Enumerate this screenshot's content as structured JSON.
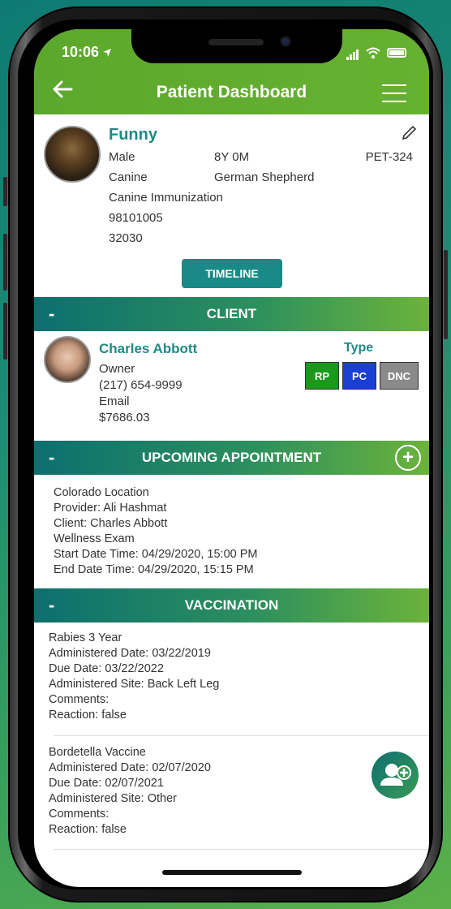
{
  "status_bar": {
    "time": "10:06"
  },
  "header": {
    "title": "Patient Dashboard"
  },
  "patient": {
    "name": "Funny",
    "sex": "Male",
    "age": "8Y 0M",
    "pet_id": "PET-324",
    "species": "Canine",
    "breed": "German Shepherd",
    "line3": "Canine Immunization",
    "line4": "98101005",
    "line5": "32030",
    "timeline_label": "TIMELINE"
  },
  "client_section": {
    "title": "CLIENT",
    "collapse": "-",
    "name": "Charles Abbott",
    "role": "Owner",
    "phone": "(217) 654-9999",
    "email": "Email",
    "balance": "$7686.03",
    "type_label": "Type",
    "tags": [
      {
        "label": "RP",
        "color": "#1a9a1a"
      },
      {
        "label": "PC",
        "color": "#1a3fd6"
      },
      {
        "label": "DNC",
        "color": "#8a8a8a"
      }
    ]
  },
  "appointment_section": {
    "title": "UPCOMING APPOINTMENT",
    "collapse": "-",
    "add": "+",
    "location": "Colorado Location",
    "provider": "Provider: Ali Hashmat",
    "client": "Client: Charles Abbott",
    "type": "Wellness Exam",
    "start": "Start Date Time: 04/29/2020, 15:00 PM",
    "end": "End Date Time: 04/29/2020, 15:15 PM"
  },
  "vaccination_section": {
    "title": "VACCINATION",
    "collapse": "-",
    "items": [
      {
        "name": "Rabies 3 Year",
        "administered": "Administered Date: 03/22/2019",
        "due": "Due Date: 03/22/2022",
        "site": "Administered Site: Back Left Leg",
        "comments": "Comments:",
        "reaction": "Reaction: false"
      },
      {
        "name": "Bordetella Vaccine",
        "administered": "Administered Date: 02/07/2020",
        "due": "Due Date: 02/07/2021",
        "site": "Administered Site: Other",
        "comments": "Comments:",
        "reaction": "Reaction: false"
      }
    ]
  },
  "icons": {
    "back": "arrow-left-icon",
    "menu": "hamburger-menu-icon",
    "edit": "pencil-icon",
    "add_user": "add-user-icon"
  },
  "colors": {
    "header_green": "#67b131",
    "teal": "#1e8a86",
    "section_gradient_start": "#0d6f6f",
    "section_gradient_end": "#6cb33b"
  }
}
